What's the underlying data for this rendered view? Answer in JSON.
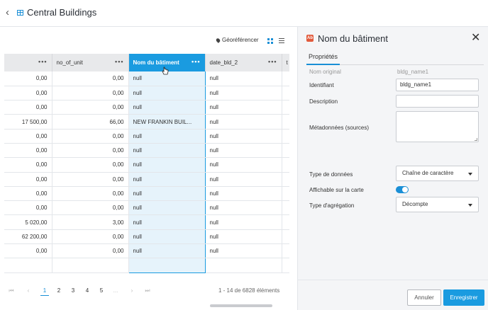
{
  "header": {
    "title": "Central Buildings"
  },
  "toolbar": {
    "georef_label": "Géoréférencer"
  },
  "table": {
    "columns": [
      {
        "label": ""
      },
      {
        "label": "no_of_unit"
      },
      {
        "label": "Nom du bâtiment"
      },
      {
        "label": "date_bld_2"
      },
      {
        "label": "t"
      }
    ],
    "rows": [
      [
        "0,00",
        "0,00",
        "null",
        "null"
      ],
      [
        "0,00",
        "0,00",
        "null",
        "null"
      ],
      [
        "0,00",
        "0,00",
        "null",
        "null"
      ],
      [
        "17 500,00",
        "66,00",
        "NEW FRANKIN BUIL...",
        "null"
      ],
      [
        "0,00",
        "0,00",
        "null",
        "null"
      ],
      [
        "0,00",
        "0,00",
        "null",
        "null"
      ],
      [
        "0,00",
        "0,00",
        "null",
        "null"
      ],
      [
        "0,00",
        "0,00",
        "null",
        "null"
      ],
      [
        "0,00",
        "0,00",
        "null",
        "null"
      ],
      [
        "0,00",
        "0,00",
        "null",
        "null"
      ],
      [
        "5 020,00",
        "3,00",
        "null",
        "null"
      ],
      [
        "62 200,00",
        "0,00",
        "null",
        "null"
      ],
      [
        "0,00",
        "0,00",
        "null",
        "null"
      ],
      [
        "",
        "",
        "",
        ""
      ]
    ]
  },
  "pagination": {
    "first": "⏮",
    "prev": "‹",
    "pages": [
      "1",
      "2",
      "3",
      "4",
      "5",
      "..."
    ],
    "next": "›",
    "last": "⏭",
    "count": "1 - 14 de 6828 éléments"
  },
  "panel": {
    "title": "Nom du bâtiment",
    "icon_text": "Ab",
    "tab": "Propriétés",
    "original_name_label": "Nom original",
    "original_name_value": "bldg_name1",
    "identifier_label": "Identifiant",
    "identifier_value": "bldg_name1",
    "description_label": "Description",
    "description_value": "",
    "metadata_label": "Métadonnées (sources)",
    "datatype_label": "Type de données",
    "datatype_value": "Chaîne de caractère",
    "displayable_label": "Affichable sur la carte",
    "displayable_on": true,
    "aggregation_label": "Type d'agrégation",
    "aggregation_value": "Décompte",
    "cancel_label": "Annuler",
    "save_label": "Enregistrer"
  },
  "colors": {
    "accent": "#1a9be0",
    "selected_cell": "#e6f3fb",
    "panel_bg": "#f4f5f7"
  }
}
